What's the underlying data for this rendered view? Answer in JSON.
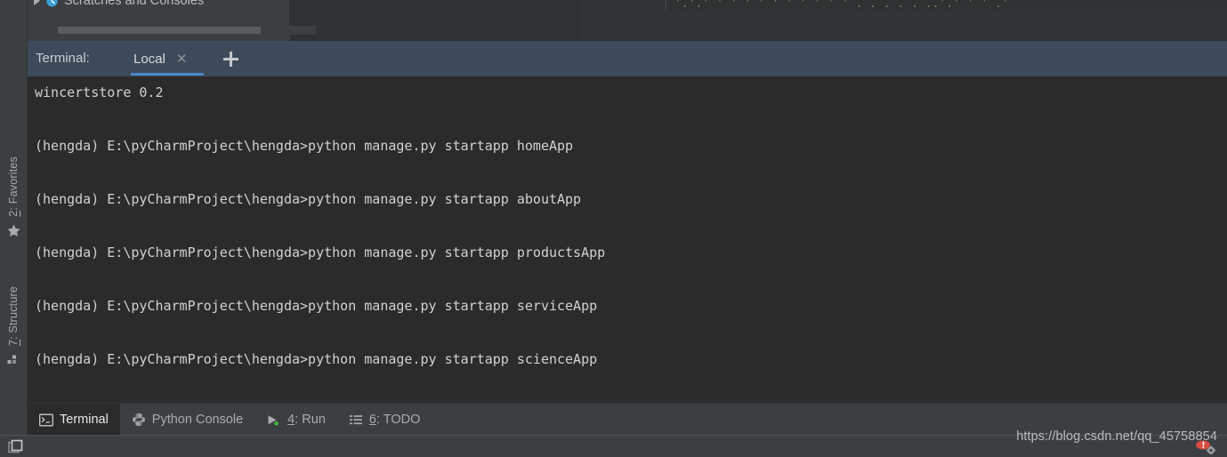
{
  "window": {
    "background_color": "#3c3f41",
    "terminal_background": "#2b2b2b",
    "tabbar_background": "#3c4a5a",
    "accent_color": "#4a88c7",
    "caret_color": "#cc7832",
    "comment_green": "#6a8759"
  },
  "project_panel": {
    "scratches_label": "Scratches and Consoles",
    "collapse_icon": "triangle-right-icon",
    "node_icon": "clock-icon",
    "scrollbar": "horizontal-scrollbar"
  },
  "editor_remnant": {
    "code_fragment": "'.'.'   ' ' ' '     ' '  '  '   ' '    . . .   .  .    ..'.' ' '      .'"
  },
  "left_rail": {
    "items": [
      {
        "label_prefix": "2",
        "label": ": Favorites",
        "icon": "star-icon",
        "name": "favorites"
      },
      {
        "label_prefix": "7",
        "label": ": Structure",
        "icon": "structure-icon",
        "name": "structure"
      }
    ]
  },
  "terminal": {
    "title": "Terminal:",
    "tab": {
      "label": "Local",
      "close_icon": "close-icon",
      "active": true,
      "editing": true
    },
    "add_tab_icon": "plus-icon",
    "lines": [
      "wincertstore 0.2",
      "",
      "",
      "(hengda) E:\\pyCharmProject\\hengda>python manage.py startapp homeApp",
      "",
      "",
      "(hengda) E:\\pyCharmProject\\hengda>python manage.py startapp aboutApp",
      "",
      "",
      "(hengda) E:\\pyCharmProject\\hengda>python manage.py startapp productsApp",
      "",
      "",
      "(hengda) E:\\pyCharmProject\\hengda>python manage.py startapp serviceApp",
      "",
      "",
      "(hengda) E:\\pyCharmProject\\hengda>python manage.py startapp scienceApp"
    ]
  },
  "bottom_bar": {
    "items": [
      {
        "label": "Terminal",
        "prefix": "",
        "icon": "terminal-icon",
        "active": true,
        "name": "terminal"
      },
      {
        "label": "Python Console",
        "prefix": "",
        "icon": "python-icon",
        "active": false,
        "name": "python-console"
      },
      {
        "label": ": Run",
        "prefix": "4",
        "icon": "run-icon",
        "active": false,
        "name": "run"
      },
      {
        "label": ": TODO",
        "prefix": "6",
        "icon": "todo-icon",
        "active": false,
        "name": "todo"
      }
    ]
  },
  "status_bar": {
    "layout_icon": "restore-layout-icon"
  },
  "watermark": {
    "url": "https://blog.csdn.net/qq_45758854",
    "badge_icon": "csdn-logo-icon"
  }
}
